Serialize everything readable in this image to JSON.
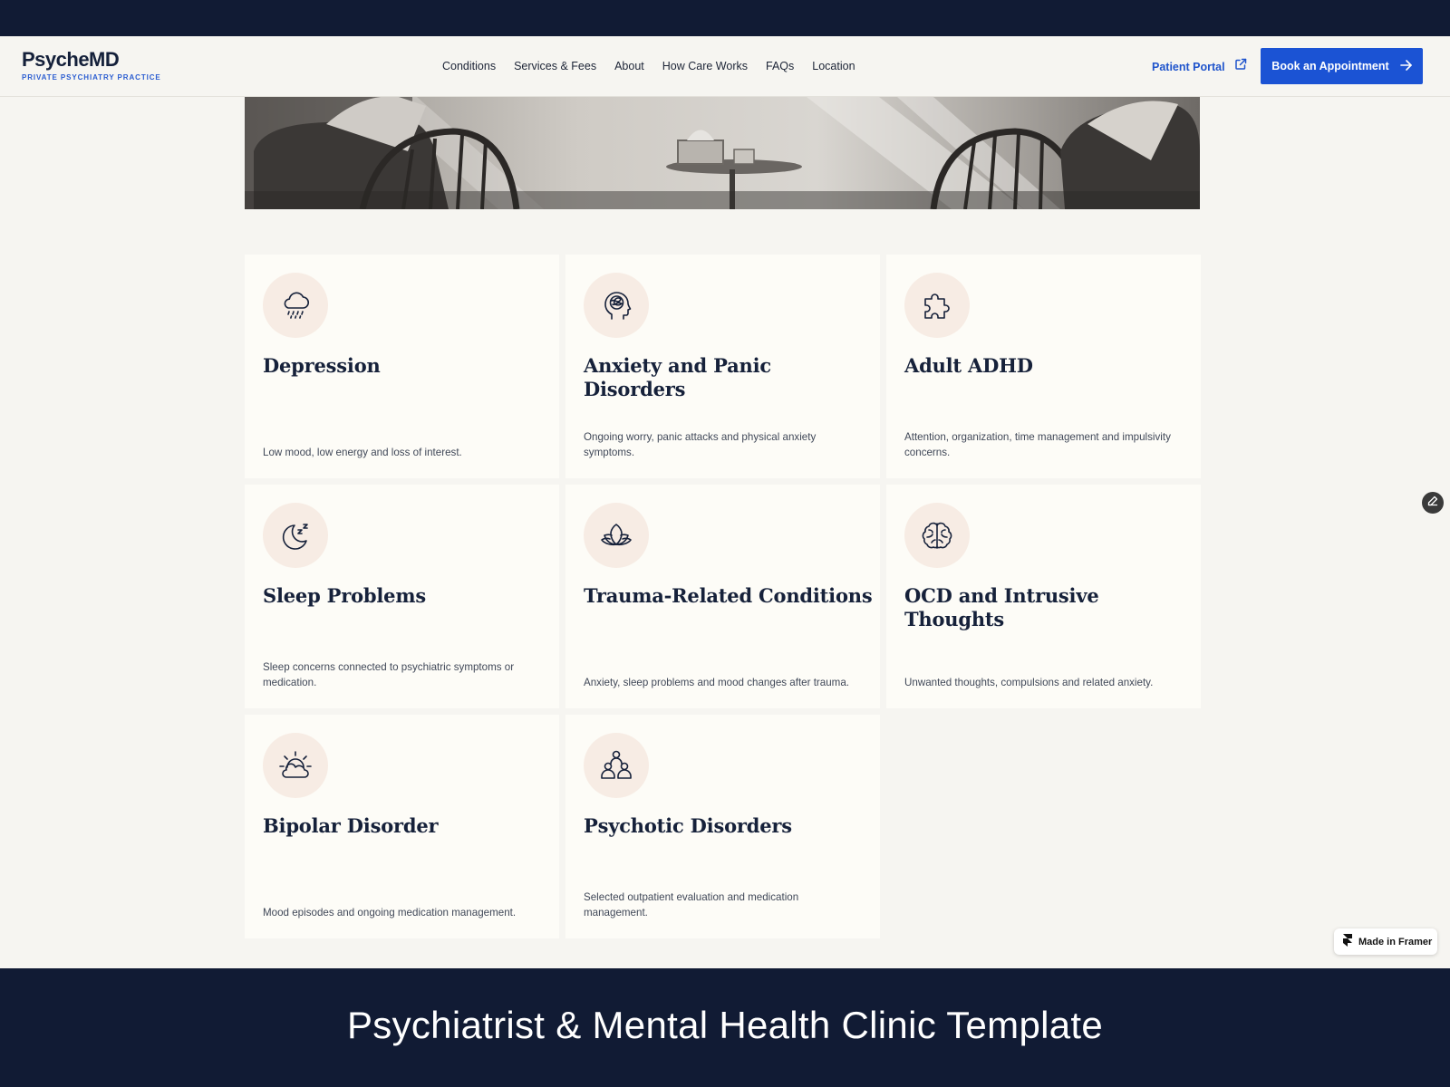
{
  "header": {
    "brand_name": "PsycheMD",
    "brand_tagline": "PRIVATE PSYCHIATRY PRACTICE",
    "nav": [
      "Conditions",
      "Services & Fees",
      "About",
      "How Care Works",
      "FAQs",
      "Location"
    ],
    "portal_label": "Patient Portal",
    "book_label": "Book an Appointment"
  },
  "hero": {
    "image": "therapy-room-chairs-photo"
  },
  "conditions": [
    {
      "title": "Depression",
      "desc": "Low mood, low energy and loss of interest.",
      "icon": "rain-cloud-icon"
    },
    {
      "title": "Anxiety and Panic Disorders",
      "desc": "Ongoing worry, panic attacks and physical anxiety symptoms.",
      "icon": "tangled-head-icon"
    },
    {
      "title": "Adult ADHD",
      "desc": "Attention, organization, time management and impulsivity concerns.",
      "icon": "puzzle-icon"
    },
    {
      "title": "Sleep Problems",
      "desc": "Sleep concerns connected to psychiatric symptoms or medication.",
      "icon": "moon-zzz-icon"
    },
    {
      "title": "Trauma-Related Conditions",
      "desc": "Anxiety, sleep problems and mood changes after trauma.",
      "icon": "lotus-icon"
    },
    {
      "title": "OCD and Intrusive Thoughts",
      "desc": "Unwanted thoughts, compulsions and related anxiety.",
      "icon": "brain-icon"
    },
    {
      "title": "Bipolar Disorder",
      "desc": "Mood episodes and ongoing medication management.",
      "icon": "sun-cloud-icon"
    },
    {
      "title": "Psychotic Disorders",
      "desc": "Selected outpatient evaluation and medication management.",
      "icon": "people-group-icon"
    }
  ],
  "badge": {
    "label": "Made in Framer"
  },
  "footer_banner": {
    "title": "Psychiatrist & Mental Health Clinic Template"
  },
  "colors": {
    "navy": "#111b34",
    "accent": "#1b53d4",
    "card_bg": "#fdfcf7",
    "icon_bg": "#f7ece4"
  }
}
